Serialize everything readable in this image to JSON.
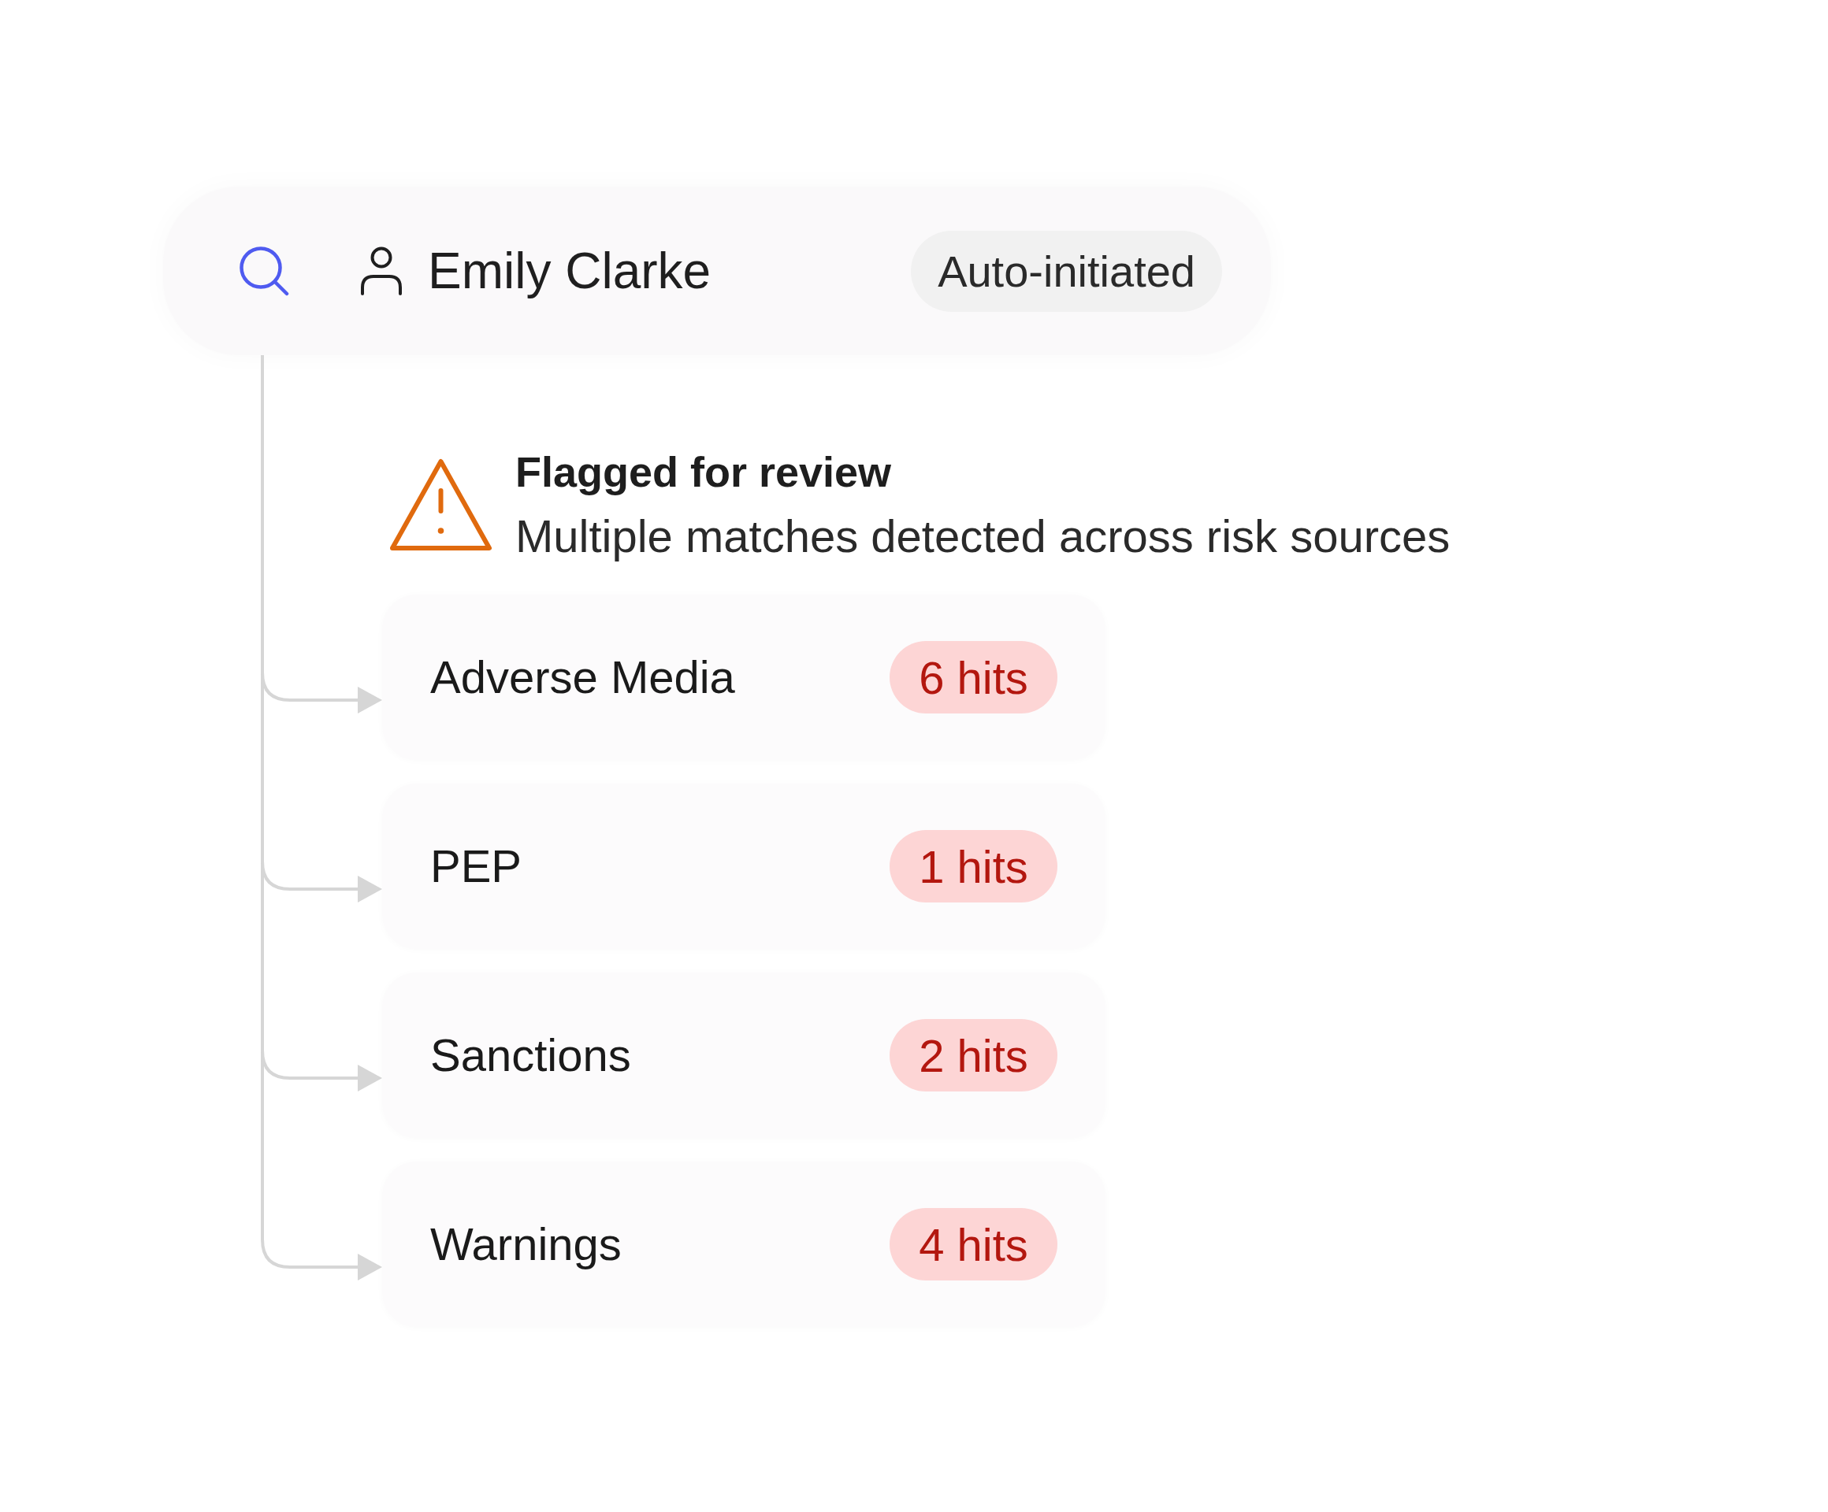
{
  "search_bar": {
    "name": "Emily Clarke",
    "status": "Auto-initiated"
  },
  "alert": {
    "title": "Flagged for review",
    "message": "Multiple matches detected across risk sources"
  },
  "sources": [
    {
      "name": "Adverse Media",
      "hits": "6 hits"
    },
    {
      "name": "PEP",
      "hits": "1 hits"
    },
    {
      "name": "Sanctions",
      "hits": "2 hits"
    },
    {
      "name": "Warnings",
      "hits": "4 hits"
    }
  ]
}
